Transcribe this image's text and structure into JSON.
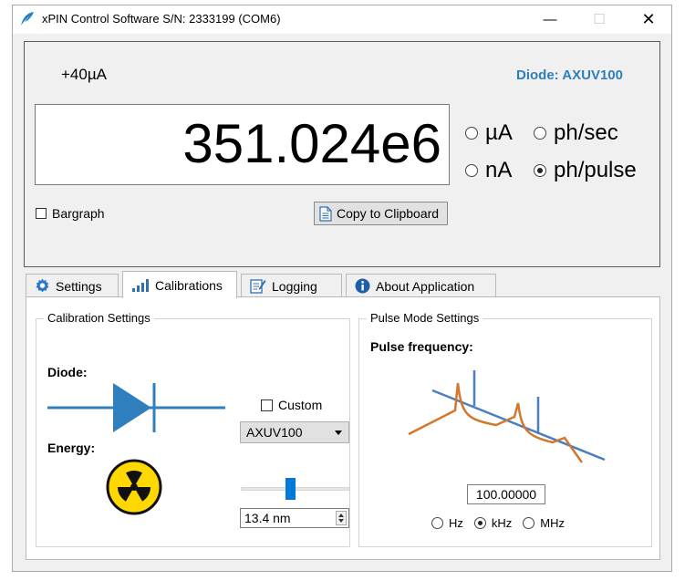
{
  "window": {
    "title": "xPIN Control Software S/N: 2333199 (COM6)",
    "controls": {
      "minimize": "—",
      "maximize": "☐",
      "close": "✕"
    }
  },
  "readout": {
    "range": "+40µA",
    "diode": "Diode: AXUV100",
    "value": "351.024e6",
    "units": [
      {
        "label": "µA",
        "selected": false
      },
      {
        "label": "ph/sec",
        "selected": false
      },
      {
        "label": "nA",
        "selected": false
      },
      {
        "label": "ph/pulse",
        "selected": true
      }
    ],
    "bargraph_label": "Bargraph",
    "bargraph_checked": false,
    "copy_label": "Copy to Clipboard"
  },
  "tabs": [
    {
      "label": "Settings",
      "icon": "gear-icon"
    },
    {
      "label": "Calibrations",
      "icon": "signal-bars-icon",
      "active": true
    },
    {
      "label": "Logging",
      "icon": "notepad-icon"
    },
    {
      "label": "About Application",
      "icon": "info-icon"
    }
  ],
  "calibration": {
    "group_title": "Calibration Settings",
    "diode_label": "Diode:",
    "custom_label": "Custom",
    "custom_checked": false,
    "diode_selected": "AXUV100",
    "energy_label": "Energy:",
    "energy_value": "13.4 nm",
    "slider_level": 0.45
  },
  "pulse": {
    "group_title": "Pulse Mode Settings",
    "freq_label": "Pulse frequency:",
    "freq_value": "100.00000",
    "freq_units": [
      {
        "label": "Hz",
        "selected": false
      },
      {
        "label": "kHz",
        "selected": true
      },
      {
        "label": "MHz",
        "selected": false
      }
    ]
  },
  "colors": {
    "accent": "#0078d7",
    "diode_label": "#2f7fb8",
    "pulse_blue": "#4a7fc1",
    "pulse_orange": "#d2772b"
  }
}
